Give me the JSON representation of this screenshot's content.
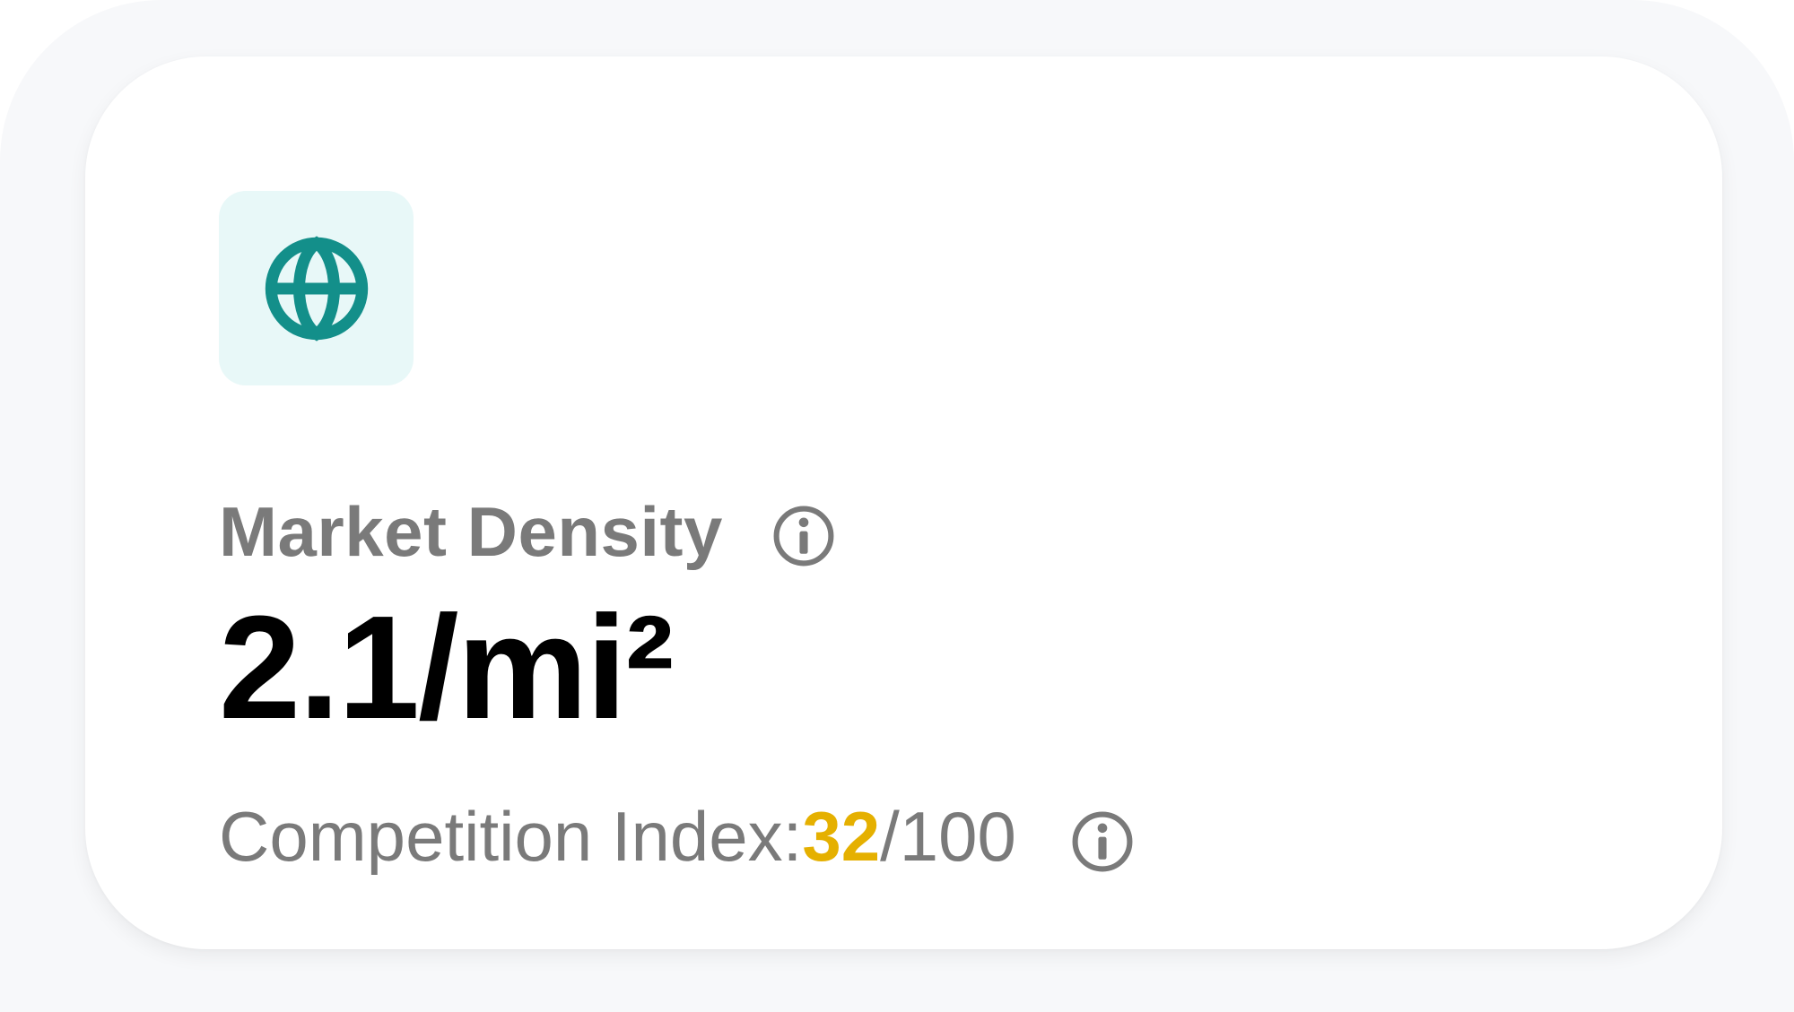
{
  "colors": {
    "accent": "#138f8a",
    "icon_tile_bg": "#e8f8f8",
    "score_highlight": "#e5b000",
    "muted_text": "#7a7a7a"
  },
  "card": {
    "icon": "globe-icon",
    "title": "Market Density",
    "value": "2.1/mi²",
    "competition_label": "Competition Index: ",
    "competition_score": "32",
    "competition_max": "/100"
  }
}
